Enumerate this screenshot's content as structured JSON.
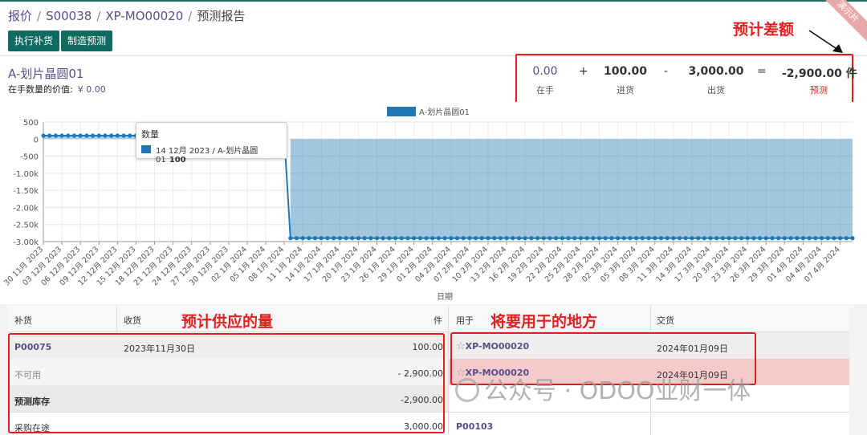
{
  "breadcrumb": [
    "报价",
    "S00038",
    "XP-MO00020",
    "预测报告"
  ],
  "buttons": {
    "replenish": "执行补货",
    "manufacture": "制造预测"
  },
  "ribbon": "演示片",
  "product": {
    "name": "A-划片晶圆01",
    "value_label": "在手数量的价值:",
    "value_amount": "¥ 0.00"
  },
  "summary": {
    "on_hand": "0.00",
    "on_hand_label": "在手",
    "op_plus": "+",
    "incoming": "100.00",
    "incoming_label": "进货",
    "op_minus": "-",
    "outgoing": "3,000.00",
    "outgoing_label": "出货",
    "op_equals": "=",
    "forecast": "-2,900.00 件",
    "forecast_label": "预测"
  },
  "annotations": {
    "gap": "预计差额",
    "supply": "预计供应的量",
    "usage": "将要用于的地方"
  },
  "tooltip": {
    "title": "数量",
    "text": "14 12月 2023 / A-划片晶圆01",
    "value": "100"
  },
  "chart_data": {
    "type": "area",
    "legend": "A-划片晶圆01",
    "legend_position": "top-center",
    "xlabel": "日期",
    "ylabel": "",
    "ylim": [
      -3000,
      500
    ],
    "yticks": [
      "500",
      "0",
      "-500",
      "-1.00k",
      "-1.50k",
      "-2.00k",
      "-2.50k",
      "-3.00k"
    ],
    "grid": true,
    "color": "#1f77b4",
    "xticks": [
      "30 11月 2023",
      "03 12月 2023",
      "06 12月 2023",
      "09 12月 2023",
      "12 12月 2023",
      "15 12月 2023",
      "18 12月 2023",
      "21 12月 2023",
      "24 12月 2023",
      "27 12月 2023",
      "30 12月 2023",
      "02 1月 2024",
      "05 1月 2024",
      "08 1月 2024",
      "11 1月 2024",
      "14 1月 2024",
      "17 1月 2024",
      "20 1月 2024",
      "23 1月 2024",
      "26 1月 2024",
      "29 1月 2024",
      "01 2月 2024",
      "04 2月 2024",
      "07 2月 2024",
      "10 2月 2024",
      "13 2月 2024",
      "16 2月 2024",
      "19 2月 2024",
      "22 2月 2024",
      "25 2月 2024",
      "28 2月 2024",
      "02 3月 2024",
      "05 3月 2024",
      "08 3月 2024",
      "11 3月 2024",
      "14 3月 2024",
      "17 3月 2024",
      "20 3月 2024",
      "23 3月 2024",
      "26 3月 2024",
      "29 3月 2024",
      "01 4月 2024",
      "04 4月 2024",
      "07 4月 2024"
    ],
    "series": [
      {
        "name": "A-划片晶圆01",
        "segments": [
          {
            "from": "2023-11-30",
            "to": "2024-01-08",
            "value": 100
          },
          {
            "from": "2024-01-09",
            "to": "2024-04-09",
            "value": -2900
          }
        ]
      }
    ]
  },
  "table": {
    "headers": {
      "replenish": "补货",
      "receipt": "收货",
      "unit": "件",
      "used_for": "用于",
      "delivery": "交货"
    },
    "rows": [
      {
        "ref": "P00075",
        "date": "2023年11月30日",
        "qty": "100.00",
        "used": "XP-MO00020",
        "delivery": "2024年01月09日"
      },
      {
        "ref": "不可用",
        "date": "",
        "qty": "- 2,900.00",
        "used": "XP-MO00020",
        "delivery": "2024年01月09日"
      },
      {
        "ref": "预测库存",
        "date": "",
        "qty": "-2,900.00",
        "used": "",
        "delivery": ""
      },
      {
        "ref": "采购在途",
        "date": "",
        "qty": "3,000.00",
        "used": "P00103",
        "delivery": ""
      }
    ]
  },
  "watermark": "公众号 · ODOO业财一体"
}
